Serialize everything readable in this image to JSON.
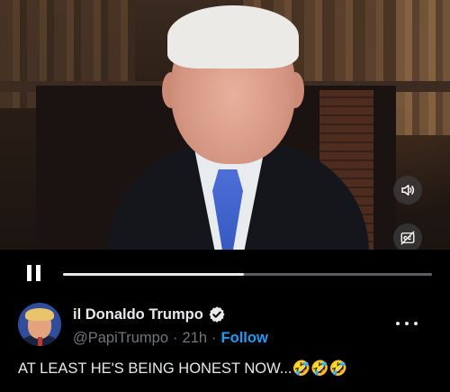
{
  "video": {
    "progress": 0.49,
    "controls": {
      "pause_icon": "pause-icon",
      "volume_icon": "speaker-icon",
      "captions_icon": "captions-off-icon"
    }
  },
  "tweet": {
    "display_name": "il Donaldo Trumpo",
    "verified_icon": "verified-badge-icon",
    "handle": "@PapiTrumpo",
    "separator": "·",
    "time": "21h",
    "follow_label": "Follow",
    "more_icon": "more-dots-icon",
    "text": "AT LEAST HE'S BEING HONEST NOW...🤣🤣🤣"
  },
  "colors": {
    "accent": "#1d9bf0",
    "text": "#e7e9ea",
    "muted": "#71767b",
    "background": "#000000"
  }
}
